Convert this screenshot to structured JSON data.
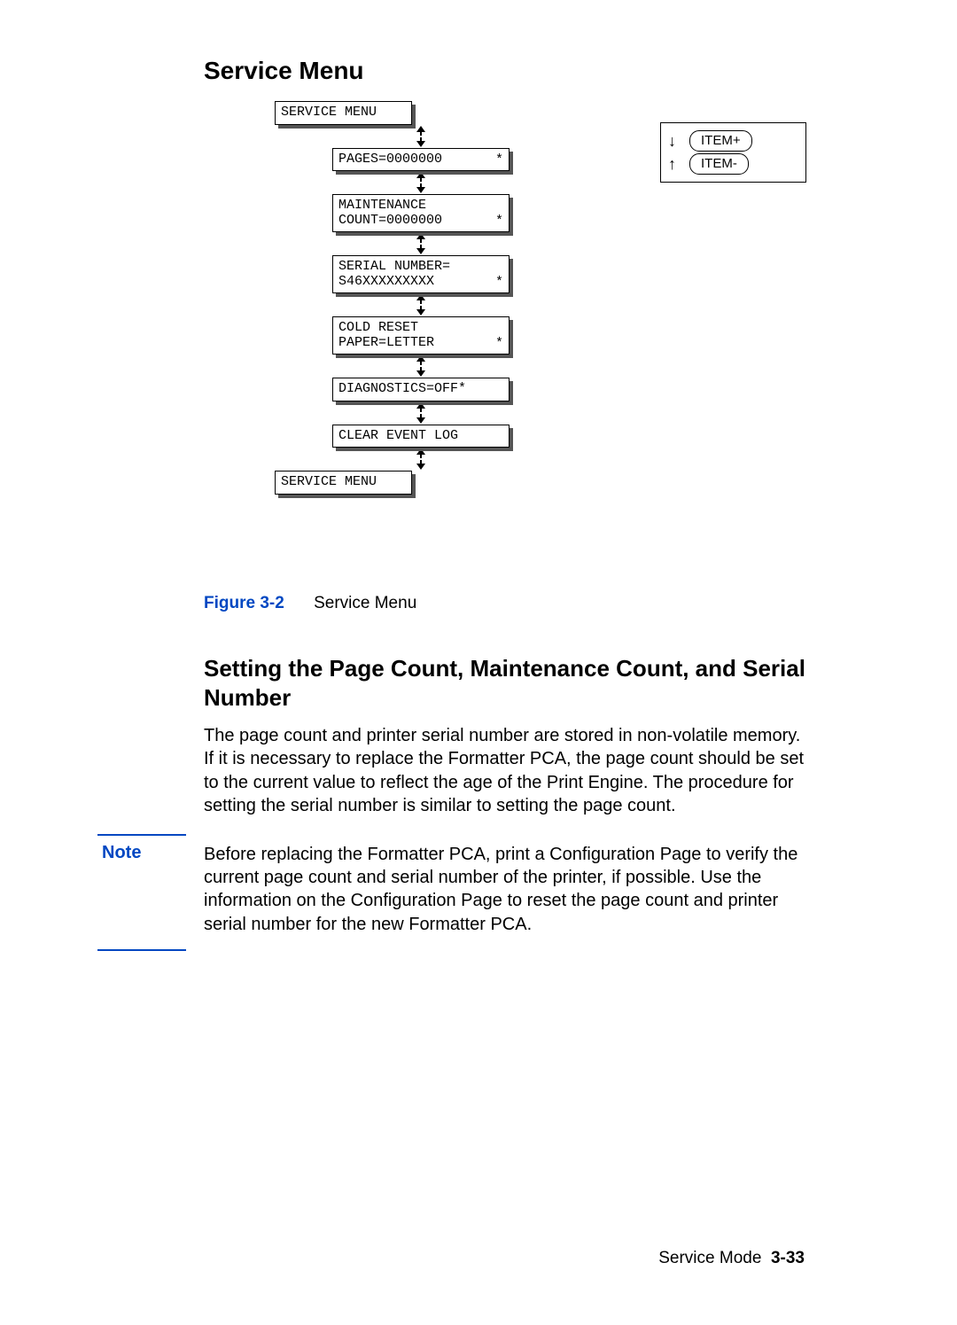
{
  "headings": {
    "service_menu": "Service Menu",
    "setting": "Setting the Page Count, Maintenance Count, and Serial Number"
  },
  "diagram": {
    "top": "SERVICE MENU",
    "items": [
      {
        "line1": "PAGES=0000000",
        "line2": "",
        "star": "*"
      },
      {
        "line1": "MAINTENANCE",
        "line2": "COUNT=0000000",
        "star": "*"
      },
      {
        "line1": "SERIAL NUMBER=",
        "line2": "S46XXXXXXXXX",
        "star": "*"
      },
      {
        "line1": "COLD RESET",
        "line2": "PAPER=LETTER",
        "star": "*"
      },
      {
        "line1": "DIAGNOSTICS=OFF*",
        "line2": "",
        "star": ""
      },
      {
        "line1": "CLEAR EVENT LOG",
        "line2": "",
        "star": ""
      }
    ],
    "bottom": "SERVICE MENU"
  },
  "legend": {
    "plus": "ITEM+",
    "minus": "ITEM-"
  },
  "figure": {
    "num": "Figure 3-2",
    "caption": "Service Menu"
  },
  "paragraphs": {
    "p1": "The page count and printer serial number are stored in non-volatile memory. If it is necessary to replace the Formatter PCA, the page count should be set to the current value to reflect the age of the Print Engine. The procedure for setting the serial number is similar to setting the page count.",
    "note_label": "Note",
    "note": "Before replacing the Formatter PCA, print a Configuration Page to verify the current page count and serial number of the printer, if possible. Use the information on the Configuration Page to reset the page count and printer serial number for the new Formatter PCA."
  },
  "footer": {
    "section": "Service Mode",
    "page": "3-33"
  }
}
